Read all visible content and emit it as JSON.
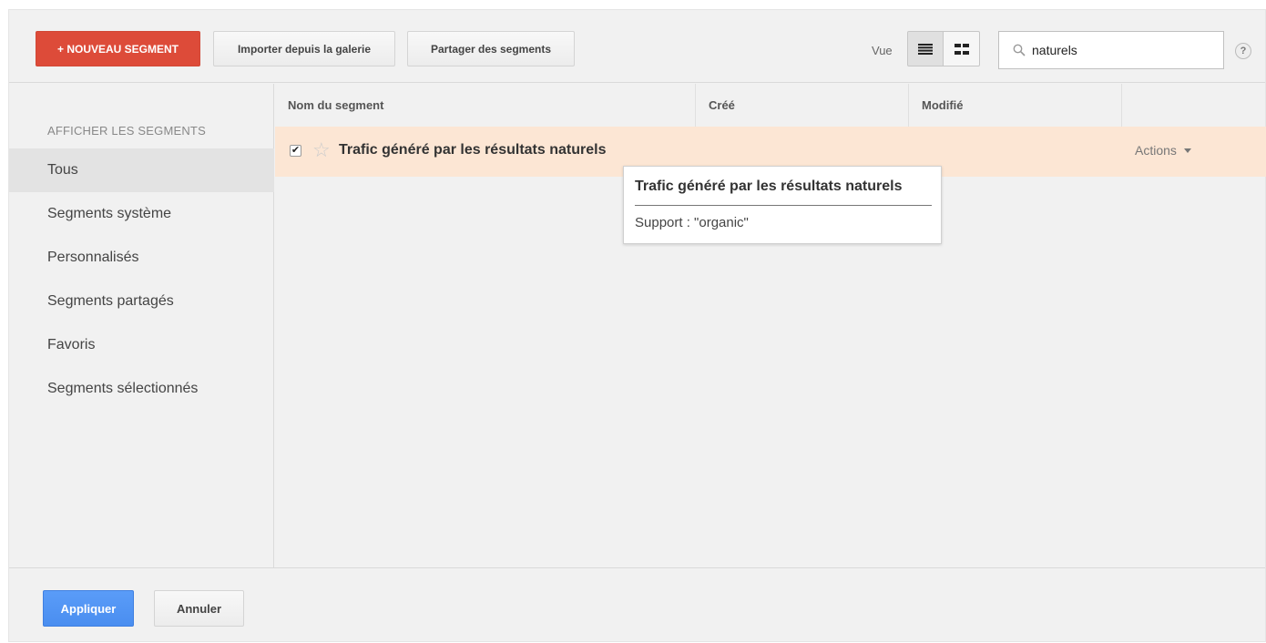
{
  "toolbar": {
    "new_segment_label": "+ NOUVEAU SEGMENT",
    "import_label": "Importer depuis la galerie",
    "share_label": "Partager des segments",
    "view_label": "Vue",
    "search_value": "naturels",
    "help_label": "?"
  },
  "sidebar": {
    "heading": "AFFICHER LES SEGMENTS",
    "items": [
      {
        "label": "Tous",
        "active": true
      },
      {
        "label": "Segments système"
      },
      {
        "label": "Personnalisés"
      },
      {
        "label": "Segments partagés"
      },
      {
        "label": "Favoris"
      },
      {
        "label": "Segments sélectionnés"
      }
    ]
  },
  "table": {
    "columns": [
      "Nom du segment",
      "Créé",
      "Modifié"
    ],
    "rows": [
      {
        "name": "Trafic généré par les résultats naturels",
        "checked": true,
        "actions_label": "Actions"
      }
    ]
  },
  "tooltip": {
    "title": "Trafic généré par les résultats naturels",
    "body": "Support : \"organic\""
  },
  "footer": {
    "apply_label": "Appliquer",
    "cancel_label": "Annuler"
  },
  "colors": {
    "accent_red": "#dd4b39",
    "accent_blue": "#4a8ef0",
    "row_highlight": "#fce6d4"
  }
}
